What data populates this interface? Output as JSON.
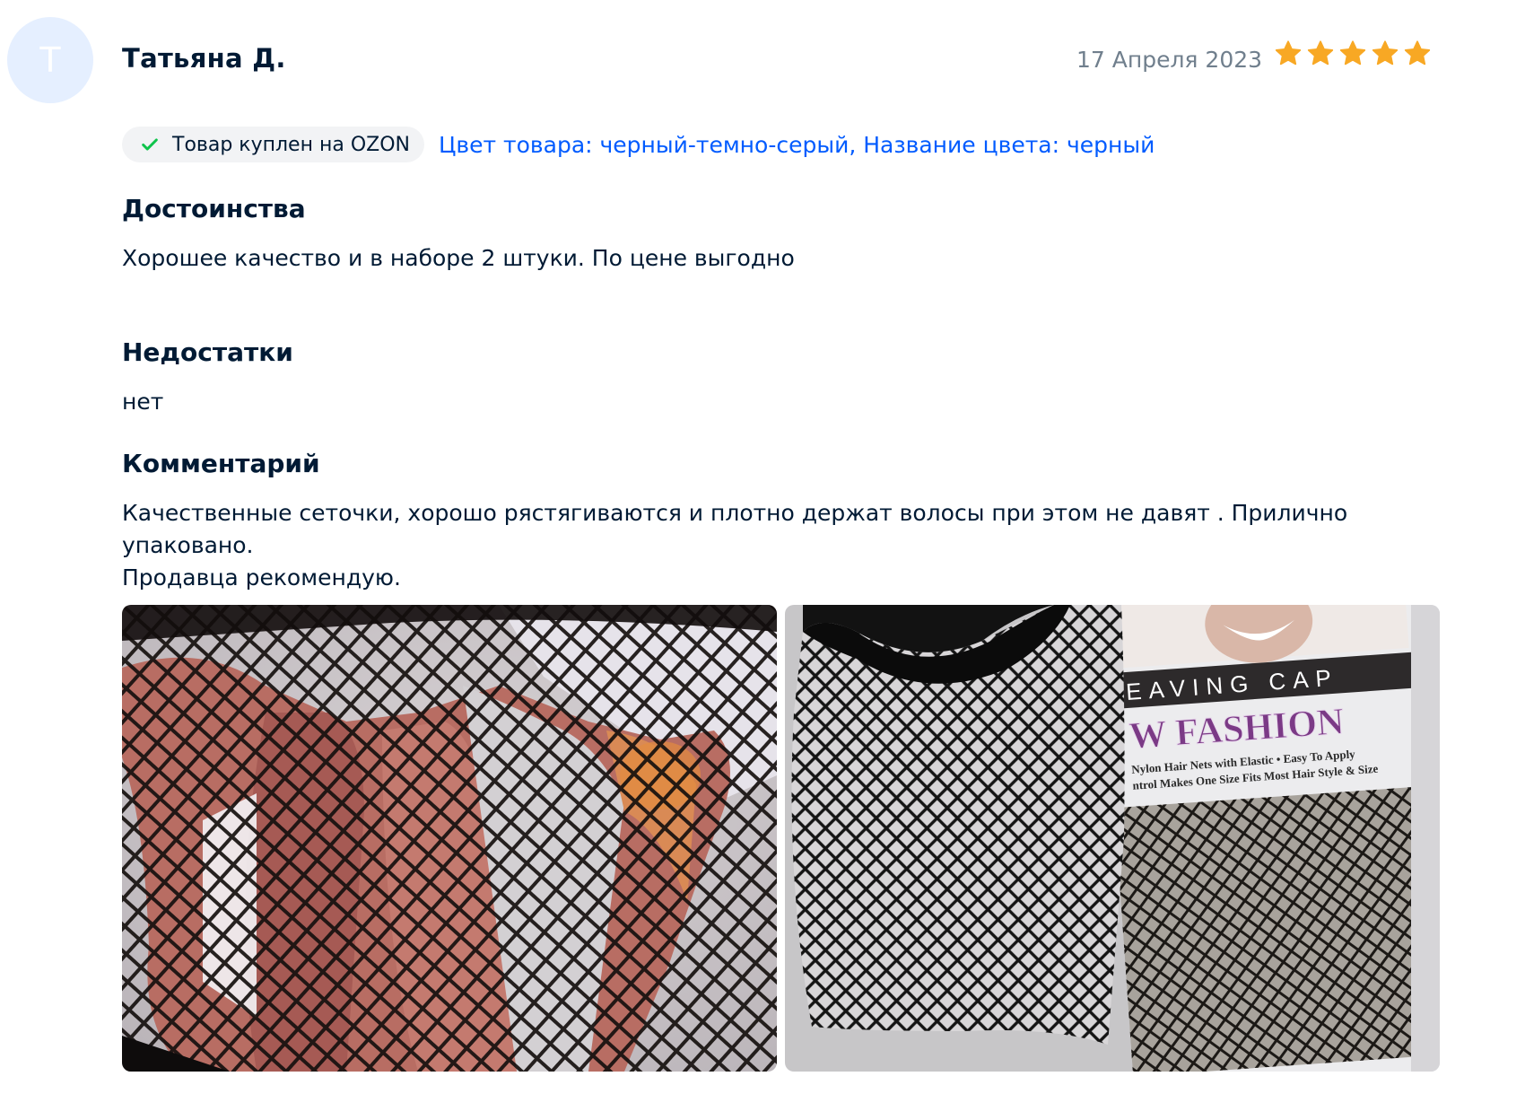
{
  "review": {
    "avatar_letter": "Т",
    "author": "Татьяна Д.",
    "date": "17 Апреля 2023",
    "rating": 5,
    "rating_max": 5,
    "star_color": "#f8a824",
    "purchased_badge": "Товар куплен на OZON",
    "variant": "Цвет товара: черный-темно-серый, Название цвета: черный",
    "advantages": {
      "title": "Достоинства",
      "text": "Хорошее качество и в наборе 2 штуки. По цене выгодно"
    },
    "disadvantages": {
      "title": "Недостатки",
      "text": "нет"
    },
    "comment": {
      "title": "Комментарий",
      "text_line1": "Качественные сеточки, хорошо рястягиваются и плотно держат волосы при этом не давят . Прилично упаковано.",
      "text_line2": "Продавца рекомендую."
    },
    "package_label_top": "EAVING CAP",
    "package_label_main": "W FASHION",
    "package_line1": "Nylon Hair Nets with Elastic  •  Easy To Apply",
    "package_line2": "ntrol Makes One Size Fits Most Hair Style & Size"
  },
  "colors": {
    "text": "#001a34",
    "muted": "#707f8d",
    "link": "#005bff",
    "check": "#10c44c",
    "avatar_bg": "#e5efff"
  }
}
